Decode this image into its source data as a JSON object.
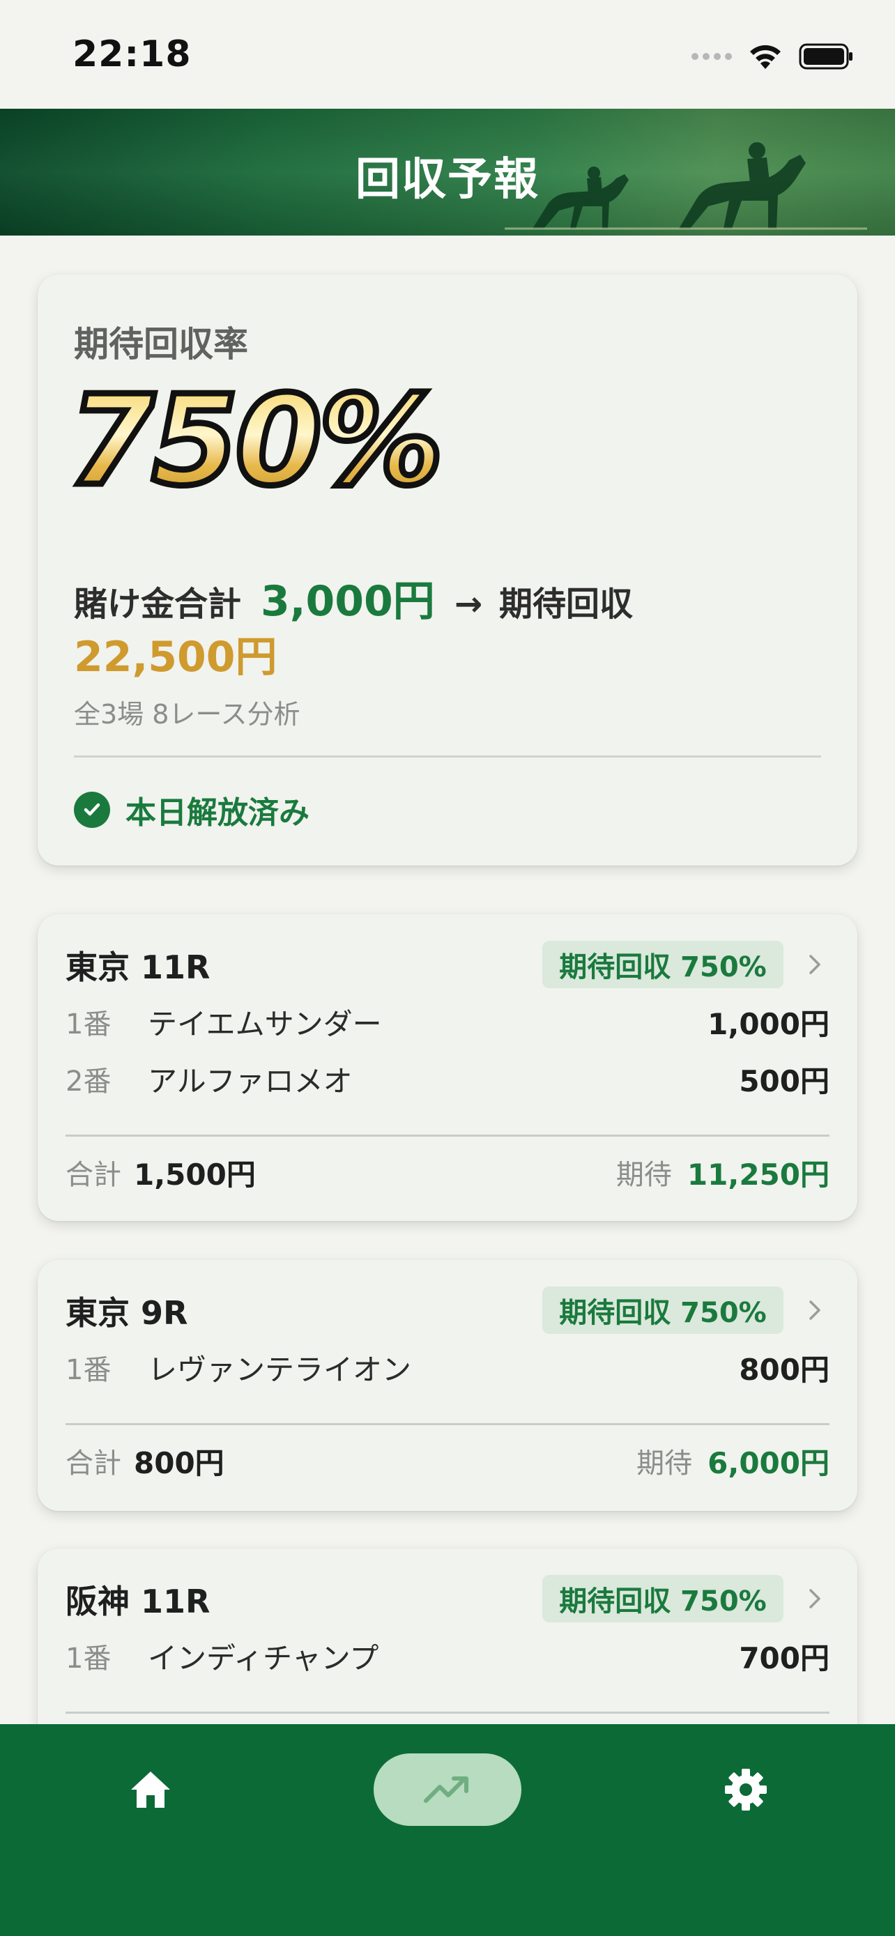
{
  "status_bar": {
    "time": "22:18"
  },
  "header": {
    "title": "回収予報"
  },
  "summary": {
    "label": "期待回収率",
    "rate": "750%",
    "bet_label": "賭け金合計",
    "bet_total": "3,000円",
    "arrow": "→",
    "expected_label": "期待回収",
    "expected_total": "22,500円",
    "analysis_note": "全3場 8レース分析",
    "status": "本日解放済み"
  },
  "races": [
    {
      "title": "東京 11R",
      "badge": "期待回収 750%",
      "entries": [
        {
          "num": "1番",
          "name": "テイエムサンダー",
          "amount": "1,000円"
        },
        {
          "num": "2番",
          "name": "アルファロメオ",
          "amount": "500円"
        }
      ],
      "total_label": "合計",
      "total": "1,500円",
      "expected_label": "期待",
      "expected": "11,250円"
    },
    {
      "title": "東京 9R",
      "badge": "期待回収 750%",
      "entries": [
        {
          "num": "1番",
          "name": "レヴァンテライオン",
          "amount": "800円"
        }
      ],
      "total_label": "合計",
      "total": "800円",
      "expected_label": "期待",
      "expected": "6,000円"
    },
    {
      "title": "阪神 11R",
      "badge": "期待回収 750%",
      "entries": [
        {
          "num": "1番",
          "name": "インディチャンプ",
          "amount": "700円"
        }
      ]
    }
  ],
  "tabbar": {
    "items": [
      {
        "icon": "home-icon",
        "active": false
      },
      {
        "icon": "trending-up-icon",
        "active": true
      },
      {
        "icon": "gear-icon",
        "active": false
      }
    ]
  },
  "colors": {
    "accent_green": "#1a7a3e",
    "gold": "#cf9a2e",
    "tabbar": "#0c6a36",
    "active_tab": "#b7dcbf"
  }
}
